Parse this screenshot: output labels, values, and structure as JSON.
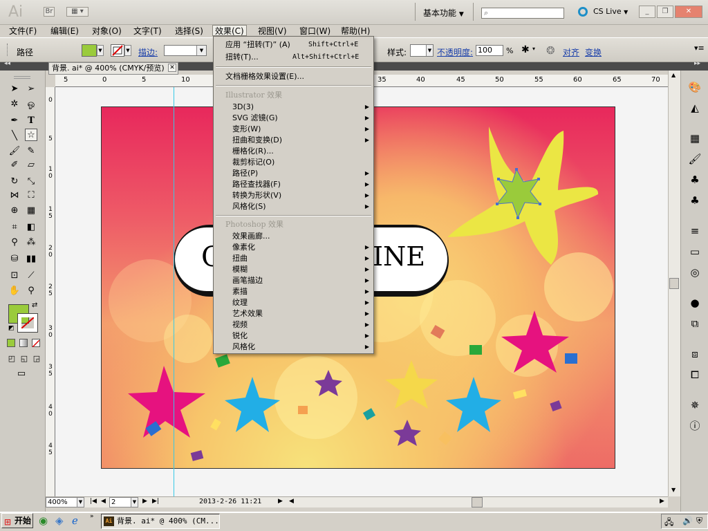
{
  "window": {
    "app_logo": "Ai",
    "bridge_label": "Br",
    "workspace": "基本功能",
    "search_placeholder": "",
    "cs_live": "CS Live",
    "minimize": "_",
    "restore": "❐",
    "close": "✕"
  },
  "menubar": [
    {
      "label": "文件(F)"
    },
    {
      "label": "编辑(E)"
    },
    {
      "label": "对象(O)"
    },
    {
      "label": "文字(T)"
    },
    {
      "label": "选择(S)"
    },
    {
      "label": "效果(C)"
    },
    {
      "label": "视图(V)"
    },
    {
      "label": "窗口(W)"
    },
    {
      "label": "帮助(H)"
    }
  ],
  "controlbar": {
    "selection_label": "路径",
    "fill_color": "#9acb3b",
    "stroke_label": "描边:",
    "style_label": "样式:",
    "opacity_label": "不透明度:",
    "opacity_value": "100",
    "opacity_unit": "%",
    "align_label": "对齐",
    "transform_label": "变换"
  },
  "document_tab": {
    "title": "背景. ai* @ 400% (CMYK/预览)",
    "close": "✕"
  },
  "ruler": {
    "h_ticks": [
      "5",
      "0",
      "5",
      "10",
      "35",
      "40",
      "45",
      "50",
      "55",
      "60",
      "65",
      "70"
    ],
    "v_ticks": [
      "0",
      "5",
      "1 0",
      "1 5",
      "2 0",
      "2 5",
      "3 0",
      "3 5",
      "4 0",
      "4 5"
    ]
  },
  "artwork": {
    "banner_left": "C",
    "banner_right": "INE"
  },
  "effect_menu": {
    "apply_last": "应用 “扭转(T)” (A)",
    "apply_last_shortcut": "Shift+Ctrl+E",
    "last_effect": "扭转(T)...",
    "last_effect_shortcut": "Alt+Shift+Ctrl+E",
    "raster_settings": "文档栅格效果设置(E)...",
    "illustrator_header": "Illustrator 效果",
    "illustrator_items": [
      {
        "label": "3D(3)",
        "sub": true
      },
      {
        "label": "SVG 滤镜(G)",
        "sub": true
      },
      {
        "label": "变形(W)",
        "sub": true
      },
      {
        "label": "扭曲和变换(D)",
        "sub": true
      },
      {
        "label": "栅格化(R)...",
        "sub": false
      },
      {
        "label": "裁剪标记(O)",
        "sub": false
      },
      {
        "label": "路径(P)",
        "sub": true
      },
      {
        "label": "路径查找器(F)",
        "sub": true
      },
      {
        "label": "转换为形状(V)",
        "sub": true
      },
      {
        "label": "风格化(S)",
        "sub": true
      }
    ],
    "photoshop_header": "Photoshop 效果",
    "photoshop_items": [
      {
        "label": "效果画廊...",
        "sub": false
      },
      {
        "label": "像素化",
        "sub": true
      },
      {
        "label": "扭曲",
        "sub": true
      },
      {
        "label": "模糊",
        "sub": true
      },
      {
        "label": "画笔描边",
        "sub": true
      },
      {
        "label": "素描",
        "sub": true
      },
      {
        "label": "纹理",
        "sub": true
      },
      {
        "label": "艺术效果",
        "sub": true
      },
      {
        "label": "视频",
        "sub": true
      },
      {
        "label": "锐化",
        "sub": true
      },
      {
        "label": "风格化",
        "sub": true
      }
    ]
  },
  "statusbar": {
    "zoom": "400%",
    "artboard_number": "2",
    "status_text": "2013-2-26  11:21"
  },
  "taskbar": {
    "start": "开始",
    "task_item": "背景. ai* @ 400% (CM..."
  },
  "colors": {
    "panel_bg": "#d4d0c8",
    "dark_header": "#4b4b4b",
    "fill_swatch": "#9acb3b",
    "guide": "#36c9e6",
    "magenta": "#e6127f",
    "cyan": "#22aee6",
    "yellow_star": "#ebe644",
    "purple": "#7b3a98"
  }
}
